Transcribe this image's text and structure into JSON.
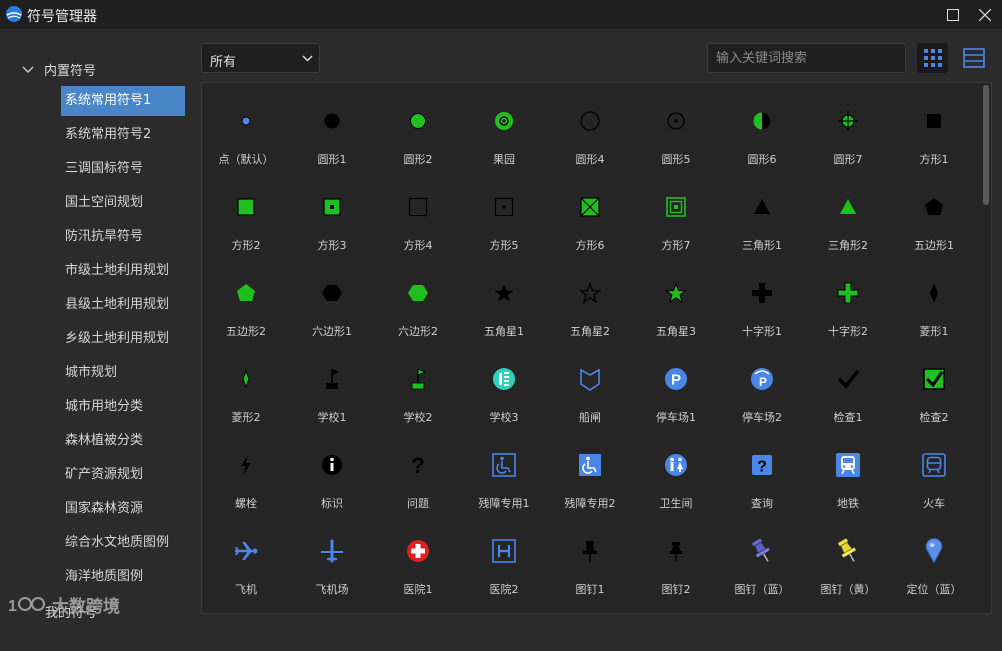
{
  "window": {
    "title": "符号管理器"
  },
  "sidebar": {
    "root_label": "内置符号",
    "items": [
      {
        "label": "系统常用符号1",
        "active": true
      },
      {
        "label": "系统常用符号2"
      },
      {
        "label": "三调国标符号"
      },
      {
        "label": "国土空间规划"
      },
      {
        "label": "防汛抗旱符号"
      },
      {
        "label": "市级土地利用规划"
      },
      {
        "label": "县级土地利用规划"
      },
      {
        "label": "乡级土地利用规划"
      },
      {
        "label": "城市规划"
      },
      {
        "label": "城市用地分类"
      },
      {
        "label": "森林植被分类"
      },
      {
        "label": "矿产资源规划"
      },
      {
        "label": "国家森林资源"
      },
      {
        "label": "综合水文地质图例"
      },
      {
        "label": "海洋地质图例"
      }
    ],
    "my_symbols_label": "我的符号",
    "watermark_text": "大数跨境"
  },
  "toolbar": {
    "filter_value": "所有",
    "search_placeholder": "输入关键词搜索",
    "view_grid_icon": "grid-view-icon",
    "view_list_icon": "list-view-icon"
  },
  "colors": {
    "accent": "#4a86c7",
    "green": "#1fbf1f",
    "blue": "#4a86e8"
  },
  "symbols": [
    {
      "label": "点（默认）",
      "icon": "dot-blue"
    },
    {
      "label": "圆形1",
      "icon": "circle-black"
    },
    {
      "label": "圆形2",
      "icon": "circle-green"
    },
    {
      "label": "果园",
      "icon": "circle-green-dot"
    },
    {
      "label": "圆形4",
      "icon": "circle-outline"
    },
    {
      "label": "圆形5",
      "icon": "circle-outline-dot"
    },
    {
      "label": "圆形6",
      "icon": "circle-half"
    },
    {
      "label": "圆形7",
      "icon": "circle-crosshair"
    },
    {
      "label": "方形1",
      "icon": "square-black"
    },
    {
      "label": "方形2",
      "icon": "square-green"
    },
    {
      "label": "方形3",
      "icon": "square-green-dot"
    },
    {
      "label": "方形4",
      "icon": "square-outline"
    },
    {
      "label": "方形5",
      "icon": "square-outline-dot"
    },
    {
      "label": "方形6",
      "icon": "square-green-x"
    },
    {
      "label": "方形7",
      "icon": "square-green-concentric"
    },
    {
      "label": "三角形1",
      "icon": "triangle-black"
    },
    {
      "label": "三角形2",
      "icon": "triangle-green"
    },
    {
      "label": "五边形1",
      "icon": "pentagon-black"
    },
    {
      "label": "五边形2",
      "icon": "pentagon-green"
    },
    {
      "label": "六边形1",
      "icon": "hexagon-black"
    },
    {
      "label": "六边形2",
      "icon": "hexagon-green"
    },
    {
      "label": "五角星1",
      "icon": "star-black"
    },
    {
      "label": "五角星2",
      "icon": "star-outline"
    },
    {
      "label": "五角星3",
      "icon": "star-green"
    },
    {
      "label": "十字形1",
      "icon": "cross-black"
    },
    {
      "label": "十字形2",
      "icon": "cross-green"
    },
    {
      "label": "菱形1",
      "icon": "diamond-black"
    },
    {
      "label": "菱形2",
      "icon": "diamond-green"
    },
    {
      "label": "学校1",
      "icon": "flag-black"
    },
    {
      "label": "学校2",
      "icon": "flag-green"
    },
    {
      "label": "学校3",
      "icon": "school-teal"
    },
    {
      "label": "船闸",
      "icon": "shiplock-blue"
    },
    {
      "label": "停车场1",
      "icon": "parking-blue"
    },
    {
      "label": "停车场2",
      "icon": "parking-wifi-blue"
    },
    {
      "label": "检查1",
      "icon": "check-black"
    },
    {
      "label": "检查2",
      "icon": "check-green-box"
    },
    {
      "label": "螺栓",
      "icon": "bolt-black"
    },
    {
      "label": "标识",
      "icon": "info-black"
    },
    {
      "label": "问题",
      "icon": "question-black"
    },
    {
      "label": "残障专用1",
      "icon": "wheelchair-outline"
    },
    {
      "label": "残障专用2",
      "icon": "wheelchair-filled"
    },
    {
      "label": "卫生间",
      "icon": "restroom-blue"
    },
    {
      "label": "查询",
      "icon": "query-blue"
    },
    {
      "label": "地铁",
      "icon": "subway-blue"
    },
    {
      "label": "火车",
      "icon": "train-blue"
    },
    {
      "label": "飞机",
      "icon": "plane-blue"
    },
    {
      "label": "飞机场",
      "icon": "airport-blue"
    },
    {
      "label": "医院1",
      "icon": "hospital-red"
    },
    {
      "label": "医院2",
      "icon": "hospital-h"
    },
    {
      "label": "图钉1",
      "icon": "pin-black"
    },
    {
      "label": "图钉2",
      "icon": "pin-black-2"
    },
    {
      "label": "图钉（蓝）",
      "icon": "pushpin-blue"
    },
    {
      "label": "图钉（黄）",
      "icon": "pushpin-yellow"
    },
    {
      "label": "定位（蓝）",
      "icon": "locate-blue"
    }
  ]
}
